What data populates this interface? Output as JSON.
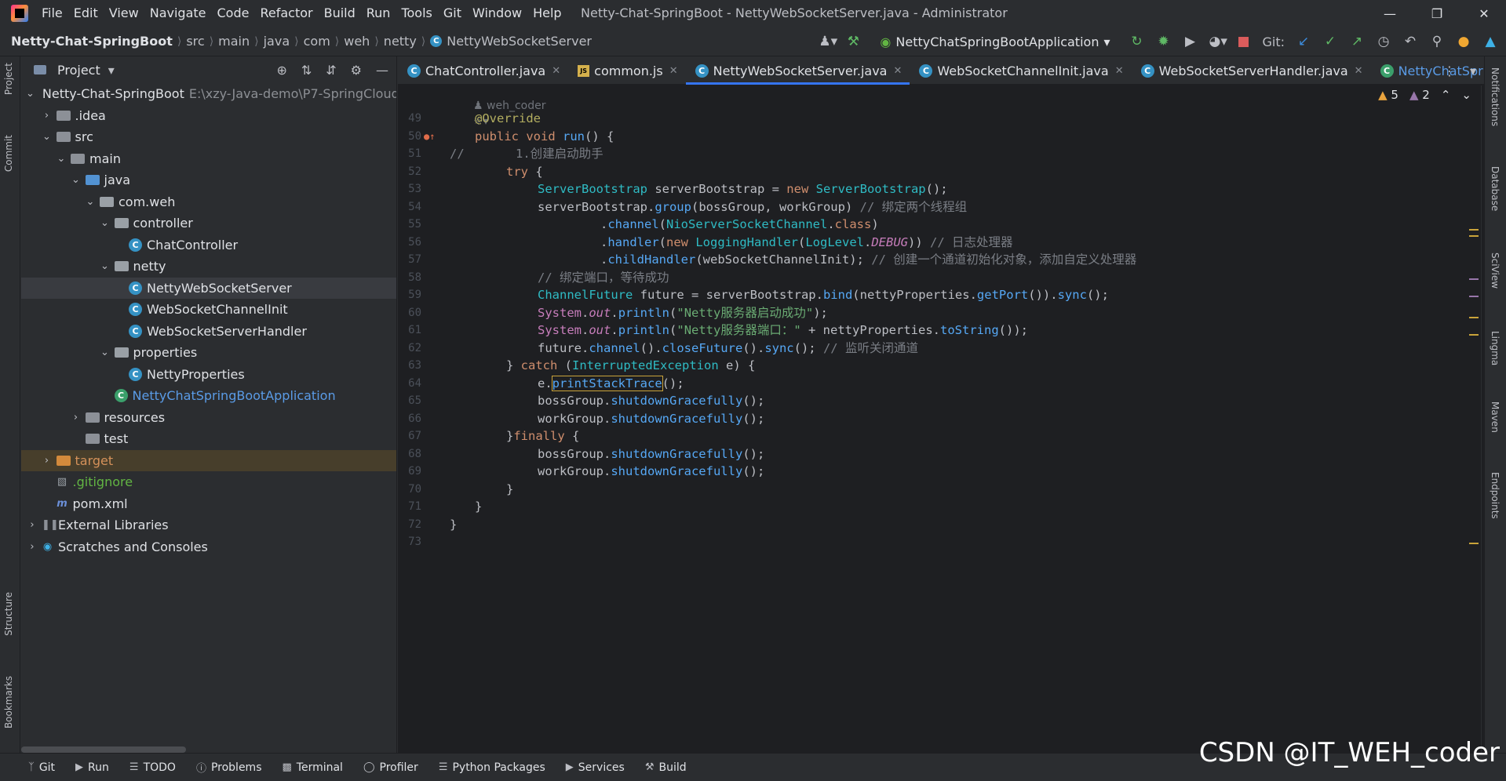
{
  "titlebar": {
    "menu": [
      "File",
      "Edit",
      "View",
      "Navigate",
      "Code",
      "Refactor",
      "Build",
      "Run",
      "Tools",
      "Git",
      "Window",
      "Help"
    ],
    "window_title": "Netty-Chat-SpringBoot - NettyWebSocketServer.java - Administrator"
  },
  "navbar": {
    "breadcrumb": [
      "Netty-Chat-SpringBoot",
      "src",
      "main",
      "java",
      "com",
      "weh",
      "netty",
      "NettyWebSocketServer"
    ],
    "run_config": "NettyChatSpringBootApplication",
    "git_label": "Git:"
  },
  "left_stripe": {
    "project": "Project",
    "commit": "Commit",
    "structure": "Structure",
    "bookmarks": "Bookmarks"
  },
  "right_stripe": [
    "Notifications",
    "Database",
    "SciView",
    "Lingma",
    "Maven",
    "Endpoints"
  ],
  "project_panel": {
    "title": "Project",
    "rows": [
      {
        "label": "Netty-Chat-SpringBoot",
        "path": "E:\\xzy-Java-demo\\P7-SpringCloud",
        "level": 0,
        "arrow": "v",
        "icon": "module"
      },
      {
        "label": ".idea",
        "level": 1,
        "arrow": ">",
        "icon": "folder"
      },
      {
        "label": "src",
        "level": 1,
        "arrow": "v",
        "icon": "folder"
      },
      {
        "label": "main",
        "level": 2,
        "arrow": "v",
        "icon": "folder"
      },
      {
        "label": "java",
        "level": 3,
        "arrow": "v",
        "icon": "folder-blue"
      },
      {
        "label": "com.weh",
        "level": 4,
        "arrow": "v",
        "icon": "package"
      },
      {
        "label": "controller",
        "level": 5,
        "arrow": "v",
        "icon": "package"
      },
      {
        "label": "ChatController",
        "level": 6,
        "arrow": "",
        "icon": "class"
      },
      {
        "label": "netty",
        "level": 5,
        "arrow": "v",
        "icon": "package"
      },
      {
        "label": "NettyWebSocketServer",
        "level": 6,
        "arrow": "",
        "icon": "class",
        "selected": true
      },
      {
        "label": "WebSocketChannelInit",
        "level": 6,
        "arrow": "",
        "icon": "class"
      },
      {
        "label": "WebSocketServerHandler",
        "level": 6,
        "arrow": "",
        "icon": "class"
      },
      {
        "label": "properties",
        "level": 5,
        "arrow": "v",
        "icon": "package"
      },
      {
        "label": "NettyProperties",
        "level": 6,
        "arrow": "",
        "icon": "class"
      },
      {
        "label": "NettyChatSpringBootApplication",
        "level": 5,
        "arrow": "",
        "icon": "springclass",
        "color": "blue"
      },
      {
        "label": "resources",
        "level": 3,
        "arrow": ">",
        "icon": "folder"
      },
      {
        "label": "test",
        "level": 3,
        "arrow": "",
        "icon": "folder"
      },
      {
        "label": "target",
        "level": 1,
        "arrow": ">",
        "icon": "folder-orange",
        "color": "orange",
        "excluded": true
      },
      {
        "label": ".gitignore",
        "level": 1,
        "arrow": "",
        "icon": "gitignore",
        "color": "green"
      },
      {
        "label": "pom.xml",
        "level": 1,
        "arrow": "",
        "icon": "maven"
      },
      {
        "label": "External Libraries",
        "level": 0,
        "arrow": ">",
        "icon": "libraries"
      },
      {
        "label": "Scratches and Consoles",
        "level": 0,
        "arrow": ">",
        "icon": "scratches"
      }
    ]
  },
  "editor": {
    "tabs": [
      {
        "label": "ChatController.java",
        "icon": "class"
      },
      {
        "label": "common.js",
        "icon": "js"
      },
      {
        "label": "NettyWebSocketServer.java",
        "icon": "class",
        "active": true
      },
      {
        "label": "WebSocketChannelInit.java",
        "icon": "class"
      },
      {
        "label": "WebSocketServerHandler.java",
        "icon": "class"
      },
      {
        "label": "NettyChatSpring",
        "icon": "springclass"
      }
    ],
    "warnings": "5",
    "weak_warnings": "2",
    "author": "weh_coder",
    "line_numbers": [
      "49",
      "50",
      "51",
      "52",
      "53",
      "54",
      "55",
      "56",
      "57",
      "58",
      "59",
      "60",
      "61",
      "62",
      "63",
      "64",
      "65",
      "66",
      "67",
      "68",
      "69",
      "70",
      "71",
      "72",
      "73"
    ],
    "strings": {
      "comment_create": "1.创建启动助手",
      "comment_bind_groups": "// 绑定两个线程组",
      "comment_log": "// 日志处理器",
      "comment_child": "// 创建一个通道初始化对象，添加自定义处理器",
      "comment_bind_port": "// 绑定端口，等待成功",
      "str_started": "\"Netty服务器启动成功\"",
      "str_port": "\"Netty服务器端口：\"",
      "comment_close": "// 监听关闭通道"
    }
  },
  "statusbar": [
    "Git",
    "Run",
    "TODO",
    "Problems",
    "Terminal",
    "Profiler",
    "Python Packages",
    "Services",
    "Build"
  ],
  "watermark": "CSDN @IT_WEH_coder",
  "colors": {
    "accent": "#3574f0",
    "keyword": "#cf8e6d",
    "string": "#6aab73",
    "method": "#56a8f5",
    "field": "#c77dbb",
    "comment": "#7a7e85"
  }
}
